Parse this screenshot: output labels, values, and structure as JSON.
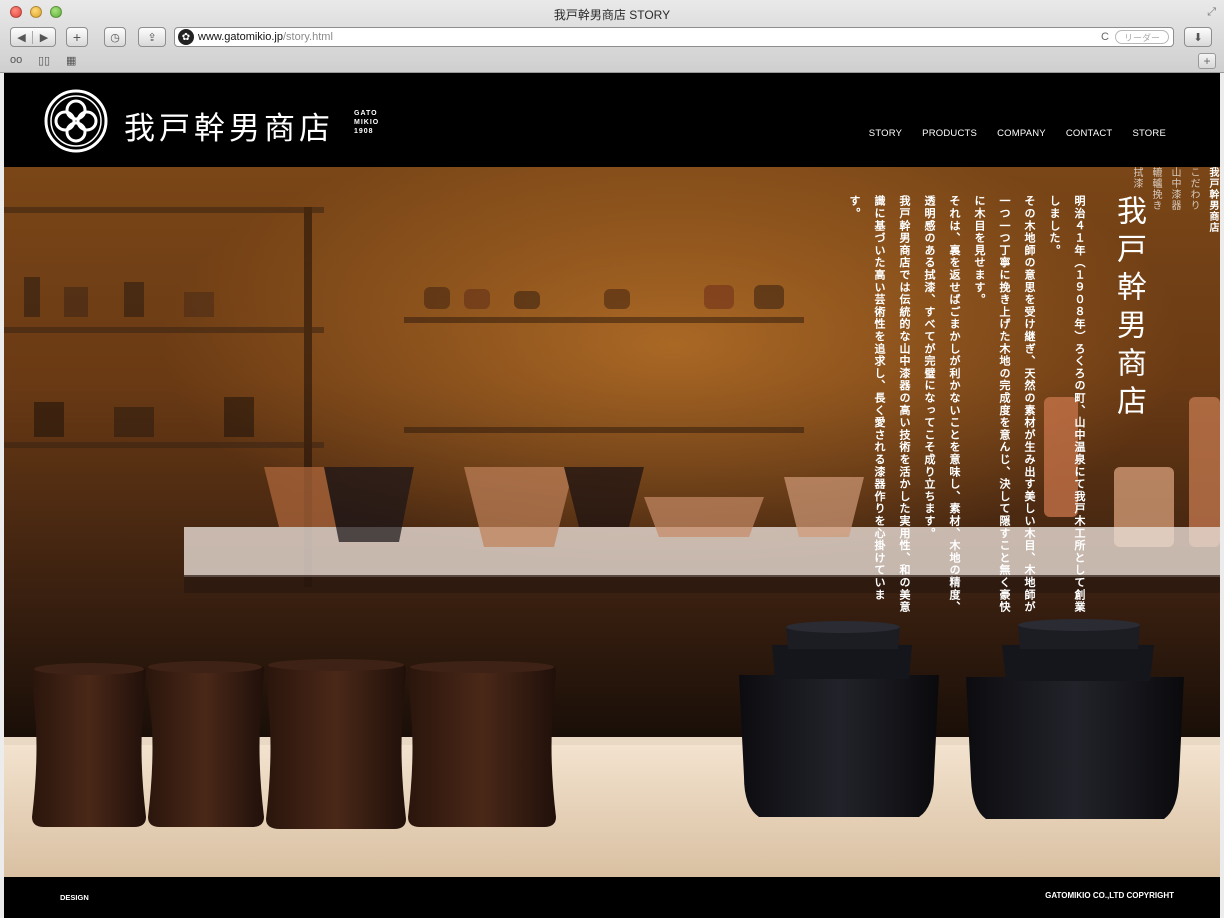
{
  "window": {
    "title": "我戸幹男商店 STORY"
  },
  "toolbar": {
    "url_domain": "www.gatomikio.jp",
    "url_path": "/story.html",
    "reader_label": "リーダー",
    "reload_icon": "C"
  },
  "site": {
    "logo_name": "我戸幹男商店",
    "logo_sub_lines": [
      "GATO",
      "MIKIO",
      "1908"
    ],
    "nav": [
      "STORY",
      "PRODUCTS",
      "COMPANY",
      "CONTACT",
      "STORE"
    ],
    "side_nav": [
      "我戸幹男商店",
      "こだわり",
      "山中漆器",
      "轆轤挽き",
      "拭漆"
    ],
    "story_title": "我戸幹男商店",
    "story_paragraphs": [
      "明治４１年（１９０８年）ろくろの町、山中温泉にて我戸木工所として創業しました。",
      "その木地師の意思を受け継ぎ、天然の素材が生み出す美しい木目、木地師が一つ一つ丁寧に挽き上げた木地の完成度を意んじ、決して隠すこと無く豪快に木目を見せます。",
      "それは、裏を返せばごまかしが利かないことを意味し、素材、木地の精度、透明感のある拭漆、すべてが完璧になってこそ成り立ちます。",
      "我戸幹男商店では伝統的な山中漆器の高い技術を活かした実用性、和の美意識に基づいた高い芸術性を追求し、長く愛される漆器作りを心掛けています。"
    ],
    "footer_left": "DESIGN",
    "footer_right": "GATOMIKIO CO.,LTD COPYRIGHT"
  }
}
